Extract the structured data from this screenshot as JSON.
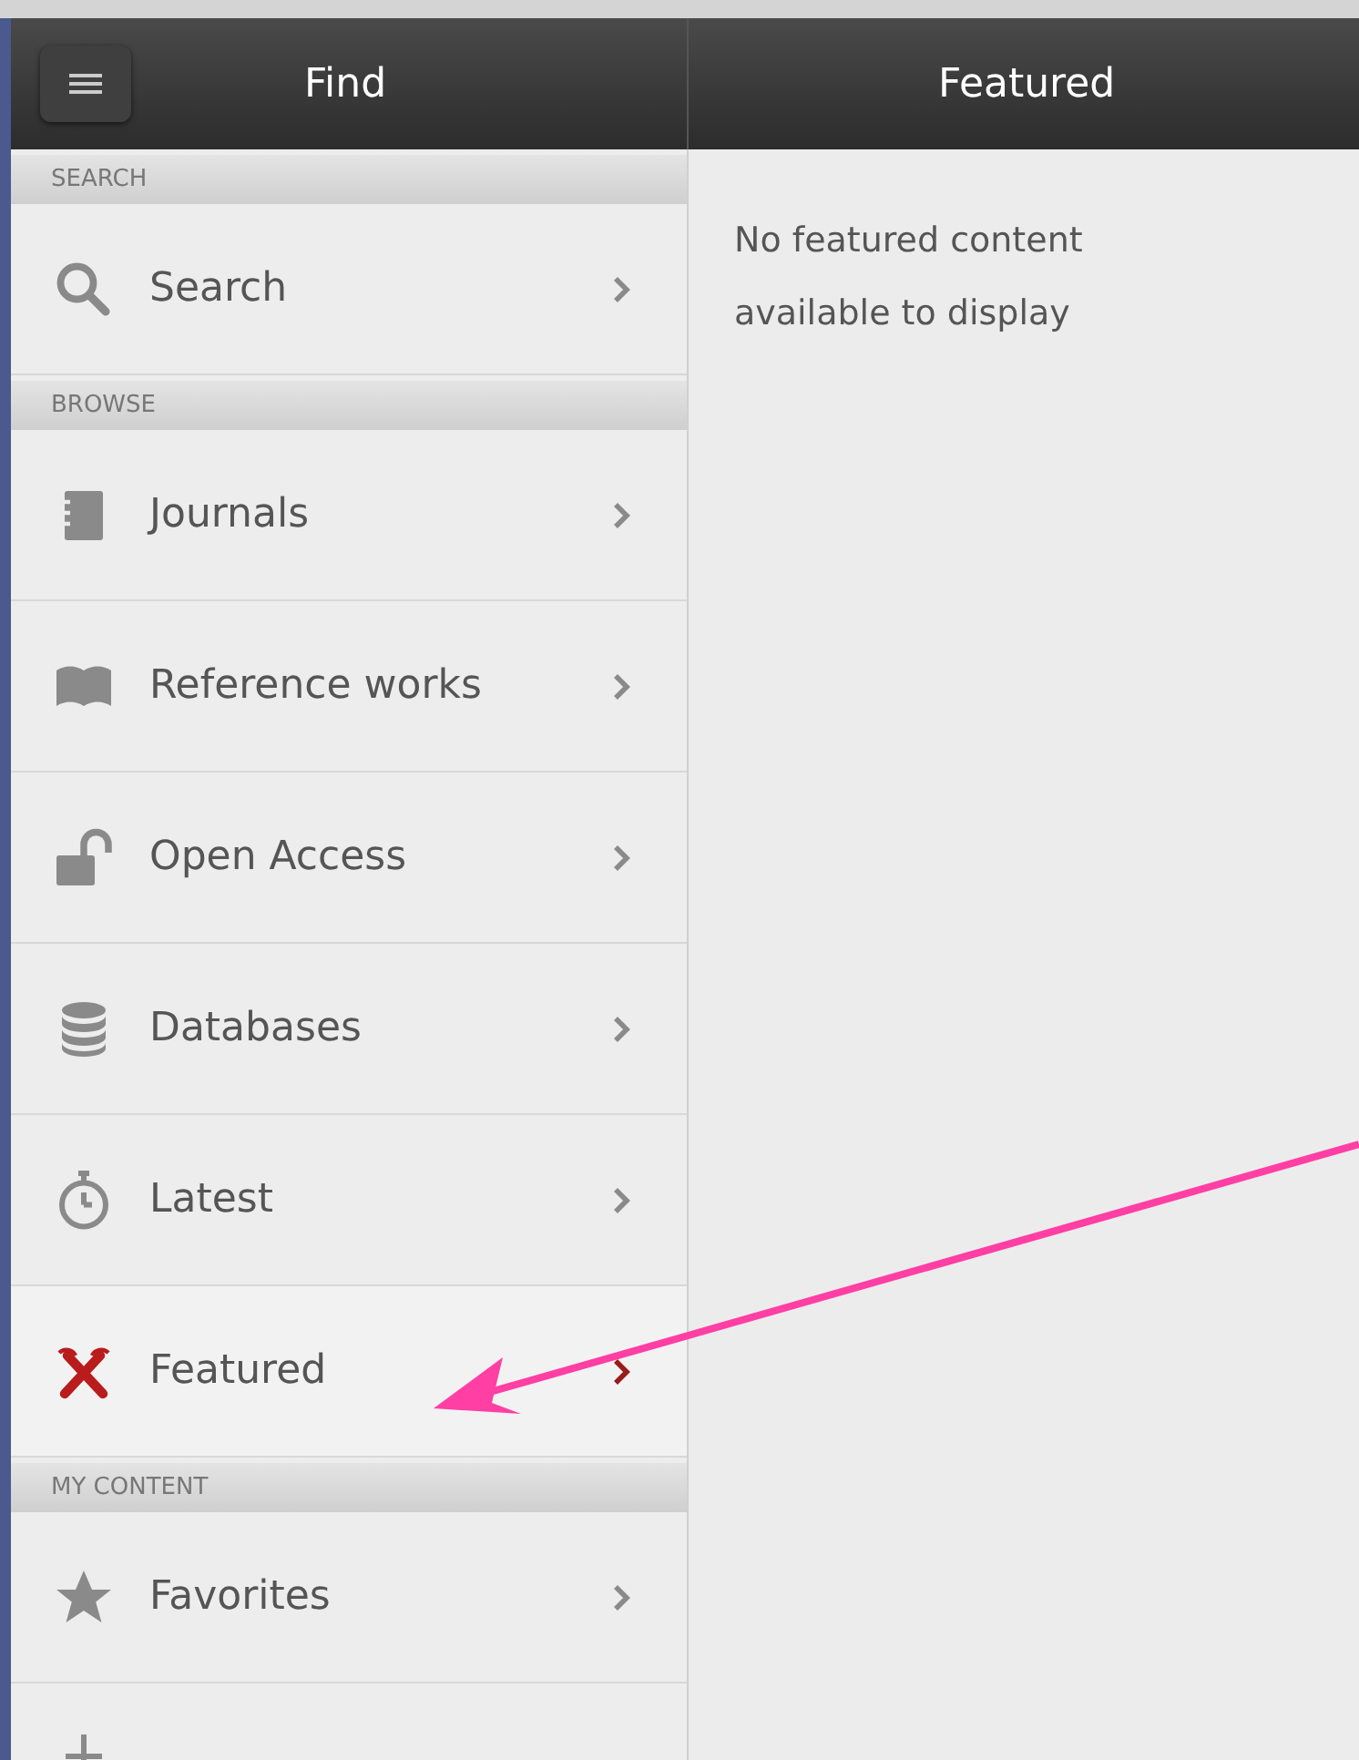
{
  "header": {
    "left_title": "Find",
    "right_title": "Featured"
  },
  "sections": [
    {
      "title": "SEARCH",
      "items": [
        {
          "label": "Search",
          "selected": false
        }
      ]
    },
    {
      "title": "BROWSE",
      "items": [
        {
          "label": "Journals",
          "selected": false
        },
        {
          "label": "Reference works",
          "selected": false
        },
        {
          "label": "Open Access",
          "selected": false
        },
        {
          "label": "Databases",
          "selected": false
        },
        {
          "label": "Latest",
          "selected": false
        },
        {
          "label": "Featured",
          "selected": true
        }
      ]
    },
    {
      "title": "MY CONTENT",
      "items": [
        {
          "label": "Favorites",
          "selected": false
        }
      ]
    }
  ],
  "content": {
    "message": "No featured content available to display"
  }
}
